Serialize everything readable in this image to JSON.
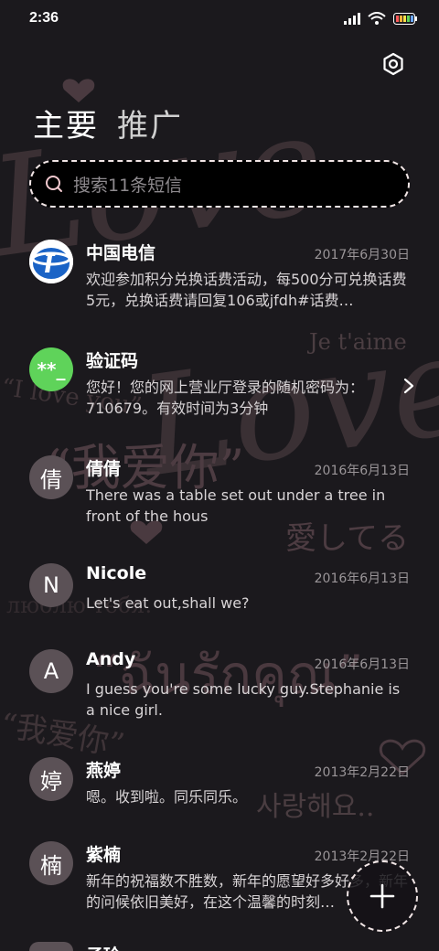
{
  "status_bar": {
    "time": "2:36"
  },
  "header": {
    "tabs": [
      {
        "label": "主要",
        "active": true
      },
      {
        "label": "推广",
        "active": false
      }
    ]
  },
  "search": {
    "placeholder": "搜索11条短信"
  },
  "conversations": [
    {
      "name": "中国电信",
      "date": "2017年6月30日",
      "preview": "欢迎参加积分兑换话费活动，每500分可兑换话费5元，兑换话费请回复106或jfdh#话费…",
      "avatar": "telecom-logo"
    },
    {
      "name": "验证码",
      "date": "",
      "preview": "您好！您的网上营业厅登录的随机密码为：710679。有效时间为3分钟",
      "avatar": "verification-code",
      "avatar_text": "**_"
    },
    {
      "name": "倩倩",
      "date": "2016年6月13日",
      "preview": "There was a table set out under a tree in front of the hous",
      "avatar_text": "倩"
    },
    {
      "name": "Nicole",
      "date": "2016年6月13日",
      "preview": "Let's eat out,shall we?",
      "avatar_text": "N"
    },
    {
      "name": "Andy",
      "date": "2016年6月13日",
      "preview": "I guess you're some lucky guy.Stephanie is a nice girl.",
      "avatar_text": "A"
    },
    {
      "name": "燕婷",
      "date": "2013年2月22日",
      "preview": "嗯。收到啦。同乐同乐。",
      "avatar_text": "婷"
    },
    {
      "name": "紫楠",
      "date": "2013年2月22日",
      "preview": "新年的祝福数不胜数，新年的愿望好多好多，新年的问候依旧美好，在这个温馨的时刻…",
      "avatar_text": "楠"
    },
    {
      "name": "子玲",
      "date": "",
      "preview": "",
      "avatar_text": ""
    }
  ],
  "wallpaper_text": [
    "Love",
    "Love",
    "Je t'aime",
    "“我爱你”",
    "愛してる",
    "“ฉันรักคุณ”",
    "사랑해요..",
    "“I love you”",
    "“我爱你”",
    "Я люблю тебя."
  ],
  "colors": {
    "background": "#1b191d",
    "accent_verify": "#5fd35a",
    "avatar": "#5b5156",
    "telecom_blue": "#1a63c6"
  },
  "icons": {
    "settings": "gear-icon",
    "search": "search-icon",
    "compose": "plus-icon",
    "open": "chevron-right-icon"
  }
}
